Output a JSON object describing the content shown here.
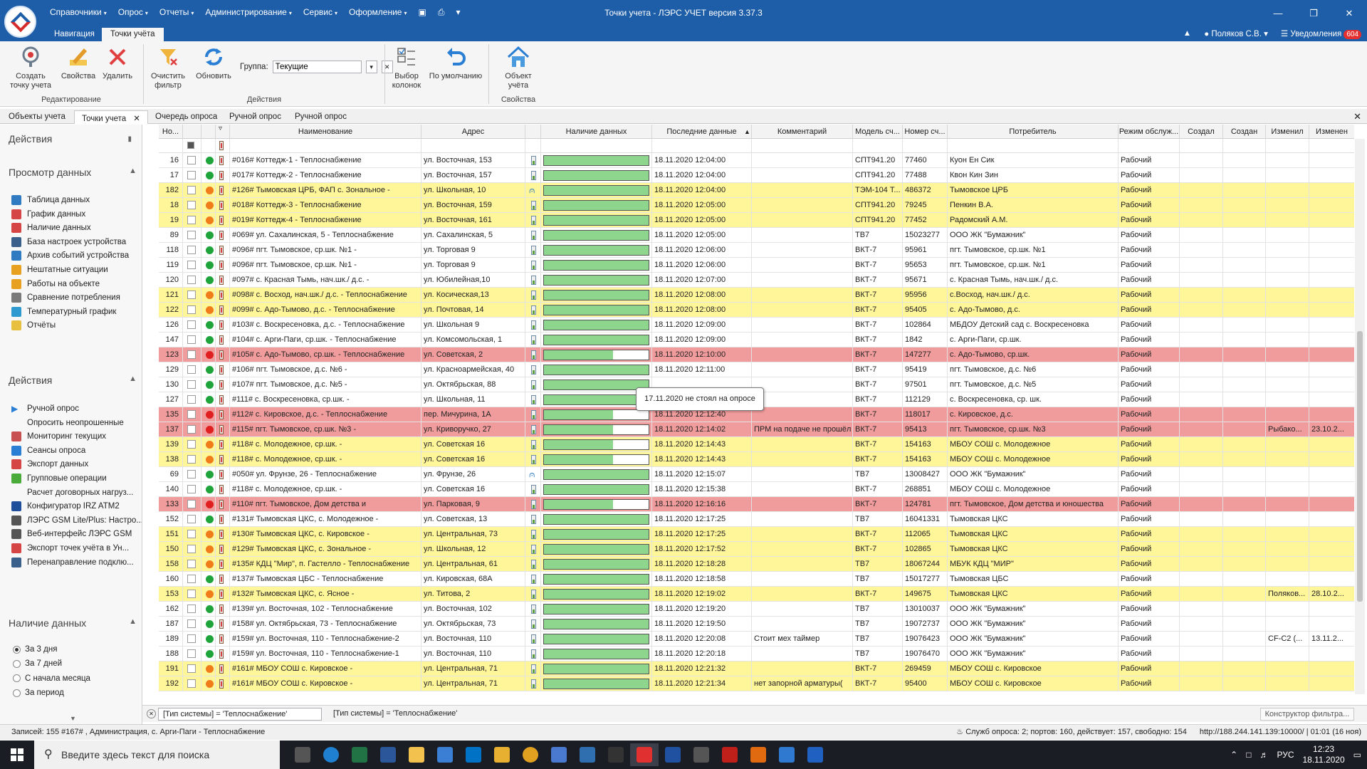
{
  "window": {
    "title": "Точки учета - ЛЭРС УЧЕТ версия 3.37.3"
  },
  "menu": [
    "Справочники",
    "Опрос",
    "Отчеты",
    "Администрирование",
    "Сервис",
    "Оформление"
  ],
  "ribbon_tabs": [
    "Навигация",
    "Точки учёта"
  ],
  "user": {
    "name": "Поляков С.В.",
    "notifications_label": "Уведомления",
    "notifications_count": "604"
  },
  "ribbon": {
    "create": "Создать точку учета",
    "properties": "Свойства",
    "delete": "Удалить",
    "clear_filter": "Очистить фильтр",
    "refresh": "Обновить",
    "group_label": "Группа:",
    "group_value": "Текущие",
    "select_columns": "Выбор колонок",
    "default": "По умолчанию",
    "object": "Объект учёта",
    "group_edit": "Редактирование",
    "group_actions": "Действия",
    "group_props": "Свойства"
  },
  "doc_tabs": [
    "Объекты учета",
    "Точки учета",
    "Очередь опроса",
    "Ручной опрос",
    "Ручной опрос"
  ],
  "left_panel": {
    "title": "Действия",
    "sections": {
      "view": "Просмотр данных",
      "actions": "Действия",
      "availability": "Наличие данных"
    },
    "view_items": [
      "Таблица данных",
      "График данных",
      "Наличие данных",
      "База настроек устройства",
      "Архив событий устройства",
      "Нештатные ситуации",
      "Работы на объекте",
      "Сравнение потребления",
      "Температурный график",
      "Отчёты"
    ],
    "action_items": [
      "Ручной опрос",
      "Опросить неопрошенные",
      "Мониторинг текущих",
      "Сеансы опроса",
      "Экспорт данных",
      "Групповые операции",
      "Расчет договорных нагруз...",
      "Конфигуратор IRZ ATM2",
      "ЛЭРС GSM Lite/Plus: Настро...",
      "Веб-интерфейс ЛЭРС GSM",
      "Экспорт точек учёта в Ун...",
      "Перенаправление подклю..."
    ],
    "availability_options": [
      "За 3 дня",
      "За 7 дней",
      "С начала месяца",
      "За период"
    ],
    "availability_selected": 0
  },
  "grid": {
    "columns": [
      "Но...",
      "",
      "",
      "",
      "Наименование",
      "Адрес",
      "",
      "Наличие данных",
      "Последние данные",
      "Комментарий",
      "Модель сч...",
      "Номер сч...",
      "Потребитель",
      "Режим обслуж...",
      "Создал",
      "Создан",
      "Изменил",
      "Изменен"
    ],
    "rows": [
      {
        "c": "white",
        "dot": "green",
        "n": "16",
        "name": "#016# Коттедж-1 - Теплоснабжение",
        "addr": "ул. Восточная, 153",
        "conn": "m",
        "fill": 1,
        "last": "18.11.2020 12:04:00",
        "comment": "",
        "model": "СПТ941.20",
        "serial": "77460",
        "consumer": "Куон Ен Сик",
        "mode": "Рабочий",
        "by": "",
        "at": ""
      },
      {
        "c": "white",
        "dot": "green",
        "n": "17",
        "name": "#017# Коттедж-2 - Теплоснабжение",
        "addr": "ул. Восточная, 157",
        "conn": "m",
        "fill": 1,
        "last": "18.11.2020 12:04:00",
        "comment": "",
        "model": "СПТ941.20",
        "serial": "77488",
        "consumer": "Квон Кин Зин",
        "mode": "Рабочий",
        "by": "",
        "at": ""
      },
      {
        "c": "yellow",
        "dot": "orange",
        "n": "182",
        "name": "#126# Тымовская ЦРБ, ФАП с. Зональное -",
        "addr": "ул. Школьная, 10",
        "conn": "r",
        "fill": 1,
        "last": "18.11.2020 12:04:00",
        "comment": "",
        "model": "ТЭМ-104 Т...",
        "serial": "486372",
        "consumer": "Тымовское ЦРБ",
        "mode": "Рабочий",
        "by": "",
        "at": ""
      },
      {
        "c": "yellow",
        "dot": "orange",
        "n": "18",
        "name": "#018# Коттедж-3 - Теплоснабжение",
        "addr": "ул. Восточная, 159",
        "conn": "m",
        "fill": 1,
        "last": "18.11.2020 12:05:00",
        "comment": "",
        "model": "СПТ941.20",
        "serial": "79245",
        "consumer": "Пенкин В.А.",
        "mode": "Рабочий",
        "by": "",
        "at": ""
      },
      {
        "c": "yellow",
        "dot": "orange",
        "n": "19",
        "name": "#019# Коттедж-4 - Теплоснабжение",
        "addr": "ул. Восточная, 161",
        "conn": "m",
        "fill": 1,
        "last": "18.11.2020 12:05:00",
        "comment": "",
        "model": "СПТ941.20",
        "serial": "77452",
        "consumer": "Радомский А.М.",
        "mode": "Рабочий",
        "by": "",
        "at": ""
      },
      {
        "c": "white",
        "dot": "green",
        "n": "89",
        "name": "#069# ул. Сахалинская, 5 - Теплоснабжение",
        "addr": "ул. Сахалинская, 5",
        "conn": "m",
        "fill": 1,
        "last": "18.11.2020 12:05:00",
        "comment": "",
        "model": "ТВ7",
        "serial": "15023277",
        "consumer": "ООО ЖК \"Бумажник\"",
        "mode": "Рабочий",
        "by": "",
        "at": ""
      },
      {
        "c": "white",
        "dot": "green",
        "n": "118",
        "name": "#096# пгт. Тымовское, ср.шк. №1 -",
        "addr": "ул. Торговая 9",
        "conn": "m",
        "fill": 1,
        "last": "18.11.2020 12:06:00",
        "comment": "",
        "model": "ВКТ-7",
        "serial": "95961",
        "consumer": "пгт. Тымовское, ср.шк. №1",
        "mode": "Рабочий",
        "by": "",
        "at": ""
      },
      {
        "c": "white",
        "dot": "green",
        "n": "119",
        "name": "#096# пгт. Тымовское, ср.шк. №1 -",
        "addr": "ул. Торговая 9",
        "conn": "m",
        "fill": 1,
        "last": "18.11.2020 12:06:00",
        "comment": "",
        "model": "ВКТ-7",
        "serial": "95653",
        "consumer": "пгт. Тымовское, ср.шк. №1",
        "mode": "Рабочий",
        "by": "",
        "at": ""
      },
      {
        "c": "white",
        "dot": "green",
        "n": "120",
        "name": "#097# с. Красная Тымь, нач.шк./ д.с. -",
        "addr": "ул. Юбилейная,10",
        "conn": "m",
        "fill": 1,
        "last": "18.11.2020 12:07:00",
        "comment": "",
        "model": "ВКТ-7",
        "serial": "95671",
        "consumer": "с. Красная Тымь, нач.шк./ д.с.",
        "mode": "Рабочий",
        "by": "",
        "at": ""
      },
      {
        "c": "yellow",
        "dot": "orange",
        "n": "121",
        "name": "#098# с. Восход, нач.шк./ д.с. - Теплоснабжение",
        "addr": "ул. Косическая,13",
        "conn": "m",
        "fill": 1,
        "last": "18.11.2020 12:08:00",
        "comment": "",
        "model": "ВКТ-7",
        "serial": "95956",
        "consumer": "с.Восход, нач.шк./ д.с.",
        "mode": "Рабочий",
        "by": "",
        "at": ""
      },
      {
        "c": "yellow",
        "dot": "orange",
        "n": "122",
        "name": "#099# с. Адо-Тымово, д.с. - Теплоснабжение",
        "addr": "ул. Почтовая, 14",
        "conn": "m",
        "fill": 1,
        "last": "18.11.2020 12:08:00",
        "comment": "",
        "model": "ВКТ-7",
        "serial": "95405",
        "consumer": "с. Адо-Тымово, д.с.",
        "mode": "Рабочий",
        "by": "",
        "at": ""
      },
      {
        "c": "white",
        "dot": "green",
        "n": "126",
        "name": "#103# с. Воскресеновка, д.с. - Теплоснабжение",
        "addr": "ул. Школьная 9",
        "conn": "m",
        "fill": 1,
        "last": "18.11.2020 12:09:00",
        "comment": "",
        "model": "ВКТ-7",
        "serial": "102864",
        "consumer": "МБДОУ Детский сад с. Воскресеновка",
        "mode": "Рабочий",
        "by": "",
        "at": ""
      },
      {
        "c": "white",
        "dot": "green",
        "n": "147",
        "name": "#104# с. Арги-Паги, ср.шк. - Теплоснабжение",
        "addr": "ул. Комсомольская, 1",
        "conn": "m",
        "fill": 1,
        "last": "18.11.2020 12:09:00",
        "comment": "",
        "model": "ВКТ-7",
        "serial": "1842",
        "consumer": "с. Арги-Паги, ср.шк.",
        "mode": "Рабочий",
        "by": "",
        "at": ""
      },
      {
        "c": "red",
        "dot": "red",
        "n": "123",
        "name": "#105# с. Адо-Тымово, ср.шк. - Теплоснабжение",
        "addr": "ул. Советская, 2",
        "conn": "m",
        "fill": 0.66,
        "last": "18.11.2020 12:10:00",
        "comment": "",
        "model": "ВКТ-7",
        "serial": "147277",
        "consumer": "с. Адо-Тымово, ср.шк.",
        "mode": "Рабочий",
        "by": "",
        "at": ""
      },
      {
        "c": "white",
        "dot": "green",
        "n": "129",
        "name": "#106# пгт. Тымовское, д.с. №6 -",
        "addr": "ул. Красноармейская, 40",
        "conn": "m",
        "fill": 1,
        "last": "18.11.2020 12:11:00",
        "comment": "",
        "model": "ВКТ-7",
        "serial": "95419",
        "consumer": "пгт. Тымовское, д.с. №6",
        "mode": "Рабочий",
        "by": "",
        "at": ""
      },
      {
        "c": "white",
        "dot": "green",
        "n": "130",
        "name": "#107# пгт. Тымовское, д.с. №5 -",
        "addr": "ул. Октябрьская, 88",
        "conn": "m",
        "fill": 1,
        "last": "",
        "comment": "",
        "model": "ВКТ-7",
        "serial": "97501",
        "consumer": "пгт. Тымовское, д.с. №5",
        "mode": "Рабочий",
        "by": "",
        "at": ""
      },
      {
        "c": "white",
        "dot": "green",
        "n": "127",
        "name": "#111# с. Воскресеновка, ср.шк. -",
        "addr": "ул. Школьная, 11",
        "conn": "m",
        "fill": 1,
        "last": "",
        "comment": "",
        "model": "ВКТ-7",
        "serial": "112129",
        "consumer": "с. Воскресеновка, ср. шк.",
        "mode": "Рабочий",
        "by": "",
        "at": ""
      },
      {
        "c": "red",
        "dot": "red",
        "n": "135",
        "name": "#112# с. Кировское, д.с. - Теплоснабжение",
        "addr": "пер. Мичурина, 1А",
        "conn": "m",
        "fill": 0.66,
        "last": "18.11.2020 12:12:40",
        "comment": "",
        "model": "ВКТ-7",
        "serial": "118017",
        "consumer": "с. Кировское, д.с.",
        "mode": "Рабочий",
        "by": "",
        "at": ""
      },
      {
        "c": "red",
        "dot": "red",
        "n": "137",
        "name": "#115# пгт. Тымовское, ср.шк. №3 -",
        "addr": "ул. Криворучко, 27",
        "conn": "m",
        "fill": 0.66,
        "last": "18.11.2020 12:14:02",
        "comment": "ПРМ на подаче не прошёл",
        "model": "ВКТ-7",
        "serial": "95413",
        "consumer": "пгт. Тымовское, ср.шк. №3",
        "mode": "Рабочий",
        "by": "Рыбако...",
        "at": "23.10.2..."
      },
      {
        "c": "yellow",
        "dot": "orange",
        "n": "139",
        "name": "#118# с. Молодежное, ср.шк. -",
        "addr": "ул. Советская 16",
        "conn": "m",
        "fill": 0.66,
        "last": "18.11.2020 12:14:43",
        "comment": "",
        "model": "ВКТ-7",
        "serial": "154163",
        "consumer": "МБОУ СОШ с. Молодежное",
        "mode": "Рабочий",
        "by": "",
        "at": ""
      },
      {
        "c": "yellow",
        "dot": "orange",
        "n": "138",
        "name": "#118# с. Молодежное, ср.шк. -",
        "addr": "ул. Советская 16",
        "conn": "m",
        "fill": 0.66,
        "last": "18.11.2020 12:14:43",
        "comment": "",
        "model": "ВКТ-7",
        "serial": "154163",
        "consumer": "МБОУ СОШ с. Молодежное",
        "mode": "Рабочий",
        "by": "",
        "at": ""
      },
      {
        "c": "white",
        "dot": "green",
        "n": "69",
        "name": "#050# ул. Фрунзе, 26 - Теплоснабжение",
        "addr": "ул. Фрунзе, 26",
        "conn": "r",
        "fill": 1,
        "last": "18.11.2020 12:15:07",
        "comment": "",
        "model": "ТВ7",
        "serial": "13008427",
        "consumer": "ООО ЖК \"Бумажник\"",
        "mode": "Рабочий",
        "by": "",
        "at": ""
      },
      {
        "c": "white",
        "dot": "green",
        "n": "140",
        "name": "#118# с. Молодежное, ср.шк. -",
        "addr": "ул. Советская 16",
        "conn": "m",
        "fill": 1,
        "last": "18.11.2020 12:15:38",
        "comment": "",
        "model": "ВКТ-7",
        "serial": "268851",
        "consumer": "МБОУ СОШ с. Молодежное",
        "mode": "Рабочий",
        "by": "",
        "at": ""
      },
      {
        "c": "red",
        "dot": "red",
        "n": "133",
        "name": "#110# пгт. Тымовское, Дом детства и",
        "addr": "ул. Парковая, 9",
        "conn": "m",
        "fill": 0.66,
        "last": "18.11.2020 12:16:16",
        "comment": "",
        "model": "ВКТ-7",
        "serial": "124781",
        "consumer": "пгт. Тымовское, Дом детства и юношества",
        "mode": "Рабочий",
        "by": "",
        "at": ""
      },
      {
        "c": "white",
        "dot": "green",
        "n": "152",
        "name": "#131# Тымовская ЦКС, с. Молодежное -",
        "addr": "ул. Советская, 13",
        "conn": "m",
        "fill": 1,
        "last": "18.11.2020 12:17:25",
        "comment": "",
        "model": "ТВ7",
        "serial": "16041331",
        "consumer": "Тымовская ЦКС",
        "mode": "Рабочий",
        "by": "",
        "at": ""
      },
      {
        "c": "yellow",
        "dot": "orange",
        "n": "151",
        "name": "#130# Тымовская ЦКС, с. Кировское -",
        "addr": "ул. Центральная, 73",
        "conn": "m",
        "fill": 1,
        "last": "18.11.2020 12:17:25",
        "comment": "",
        "model": "ВКТ-7",
        "serial": "112065",
        "consumer": "Тымовская ЦКС",
        "mode": "Рабочий",
        "by": "",
        "at": ""
      },
      {
        "c": "yellow",
        "dot": "orange",
        "n": "150",
        "name": "#129# Тымовская ЦКС, с. Зональное -",
        "addr": "ул. Школьная, 12",
        "conn": "m",
        "fill": 1,
        "last": "18.11.2020 12:17:52",
        "comment": "",
        "model": "ВКТ-7",
        "serial": "102865",
        "consumer": "Тымовская ЦКС",
        "mode": "Рабочий",
        "by": "",
        "at": ""
      },
      {
        "c": "yellow",
        "dot": "orange",
        "n": "158",
        "name": "#135# КДЦ \"Мир\", п. Гастелло - Теплоснабжение",
        "addr": "ул. Центральная, 61",
        "conn": "m",
        "fill": 1,
        "last": "18.11.2020 12:18:28",
        "comment": "",
        "model": "ТВ7",
        "serial": "18067244",
        "consumer": "МБУК КДЦ \"МИР\"",
        "mode": "Рабочий",
        "by": "",
        "at": ""
      },
      {
        "c": "white",
        "dot": "green",
        "n": "160",
        "name": "#137# Тымовская ЦБС - Теплоснабжение",
        "addr": "ул. Кировская, 68А",
        "conn": "m",
        "fill": 1,
        "last": "18.11.2020 12:18:58",
        "comment": "",
        "model": "ТВ7",
        "serial": "15017277",
        "consumer": "Тымовская ЦБС",
        "mode": "Рабочий",
        "by": "",
        "at": ""
      },
      {
        "c": "yellow",
        "dot": "orange",
        "n": "153",
        "name": "#132# Тымовская ЦКС, с. Ясное -",
        "addr": "ул. Титова, 2",
        "conn": "m",
        "fill": 1,
        "last": "18.11.2020 12:19:02",
        "comment": "",
        "model": "ВКТ-7",
        "serial": "149675",
        "consumer": "Тымовская ЦКС",
        "mode": "Рабочий",
        "by": "Поляков...",
        "at": "28.10.2..."
      },
      {
        "c": "white",
        "dot": "green",
        "n": "162",
        "name": "#139# ул. Восточная, 102 - Теплоснабжение",
        "addr": "ул. Восточная, 102",
        "conn": "m",
        "fill": 1,
        "last": "18.11.2020 12:19:20",
        "comment": "",
        "model": "ТВ7",
        "serial": "13010037",
        "consumer": "ООО ЖК \"Бумажник\"",
        "mode": "Рабочий",
        "by": "",
        "at": ""
      },
      {
        "c": "white",
        "dot": "green",
        "n": "187",
        "name": "#158# ул. Октябрьская, 73 - Теплоснабжение",
        "addr": "ул. Октябрьская, 73",
        "conn": "m",
        "fill": 1,
        "last": "18.11.2020 12:19:50",
        "comment": "",
        "model": "ТВ7",
        "serial": "19072737",
        "consumer": "ООО ЖК \"Бумажник\"",
        "mode": "Рабочий",
        "by": "",
        "at": ""
      },
      {
        "c": "white",
        "dot": "green",
        "n": "189",
        "name": "#159# ул. Восточная, 110 - Теплоснабжение-2",
        "addr": "ул. Восточная, 110",
        "conn": "m",
        "fill": 1,
        "last": "18.11.2020 12:20:08",
        "comment": "Стоит мех таймер",
        "model": "ТВ7",
        "serial": "19076423",
        "consumer": "ООО ЖК \"Бумажник\"",
        "mode": "Рабочий",
        "by": "СF-C2 (...",
        "at": "13.11.2..."
      },
      {
        "c": "white",
        "dot": "green",
        "n": "188",
        "name": "#159# ул. Восточная, 110 - Теплоснабжение-1",
        "addr": "ул. Восточная, 110",
        "conn": "m",
        "fill": 1,
        "last": "18.11.2020 12:20:18",
        "comment": "",
        "model": "ТВ7",
        "serial": "19076470",
        "consumer": "ООО ЖК \"Бумажник\"",
        "mode": "Рабочий",
        "by": "",
        "at": ""
      },
      {
        "c": "yellow",
        "dot": "orange",
        "n": "191",
        "name": "#161# МБОУ СОШ с. Кировское -",
        "addr": "ул. Центральная, 71",
        "conn": "m",
        "fill": 1,
        "last": "18.11.2020 12:21:32",
        "comment": "",
        "model": "ВКТ-7",
        "serial": "269459",
        "consumer": "МБОУ СОШ с. Кировское",
        "mode": "Рабочий",
        "by": "",
        "at": ""
      },
      {
        "c": "yellow",
        "dot": "orange",
        "n": "192",
        "name": "#161# МБОУ СОШ с. Кировское -",
        "addr": "ул. Центральная, 71",
        "conn": "m",
        "fill": 1,
        "last": "18.11.2020 12:21:34",
        "comment": "нет запорной арматуры(",
        "model": "ВКТ-7",
        "serial": "95400",
        "consumer": "МБОУ СОШ с. Кировское",
        "mode": "Рабочий",
        "by": "",
        "at": ""
      }
    ]
  },
  "tooltip": "17.11.2020 не стоял на опросе",
  "filter": {
    "combo": "[Тип системы] = 'Теплоснабжение'",
    "text": "[Тип системы] = 'Теплоснабжение'",
    "constructor": "Конструктор фильтра..."
  },
  "status": {
    "left": "Записей: 155    #167# , Администрация, с. Арги-Паги - Теплоснабжение",
    "service": "Служб опроса: 2; портов: 160, действует: 157, свободно: 154",
    "url": "http://188.244.141.139:10000/ | 01:01 (16 ноя)"
  },
  "taskbar": {
    "search_placeholder": "Введите здесь текст для поиска",
    "lang": "РУС",
    "time": "12:23",
    "date": "18.11.2020"
  },
  "colors": {
    "title_blue": "#1e5ea8",
    "row_yellow": "#fff599",
    "row_red": "#f19c9c",
    "bar_green": "#8ed68e"
  }
}
